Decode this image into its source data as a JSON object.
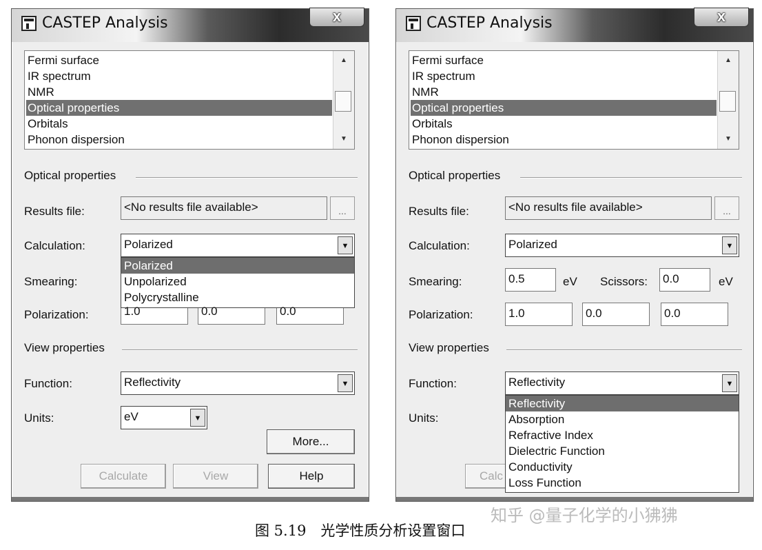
{
  "window_title": "CASTEP Analysis",
  "close_glyph": "x",
  "list_items": [
    "Fermi surface",
    "IR spectrum",
    "NMR",
    "Optical properties",
    "Orbitals",
    "Phonon dispersion"
  ],
  "optical_group": "Optical properties",
  "view_group": "View properties",
  "labels": {
    "results_file": "Results file:",
    "calculation": "Calculation:",
    "smearing": "Smearing:",
    "polarization": "Polarization:",
    "function": "Function:",
    "units": "Units:",
    "ev": "eV",
    "scissors": "Scissors:"
  },
  "results_file_value": "<No results file available>",
  "ellipsis_label": "...",
  "calculation_value": "Polarized",
  "calculation_options": [
    "Polarized",
    "Unpolarized",
    "Polycrystalline"
  ],
  "smearing_value": "0.5",
  "scissors_value": "0.0",
  "polarization_values": [
    "1.0",
    "0.0",
    "0.0"
  ],
  "function_value": "Reflectivity",
  "function_options": [
    "Reflectivity",
    "Absorption",
    "Refractive Index",
    "Dielectric Function",
    "Conductivity",
    "Loss Function"
  ],
  "units_value": "eV",
  "buttons": {
    "more": "More...",
    "calculate": "Calculate",
    "calculate_partial": "Calc",
    "view": "View",
    "help": "Help"
  },
  "caption": "图 5.19　光学性质分析设置窗口",
  "watermark": "知乎 @量子化学的小狒狒",
  "colors": {
    "selection": "#707070",
    "dialog_bg": "#eeeeee"
  }
}
